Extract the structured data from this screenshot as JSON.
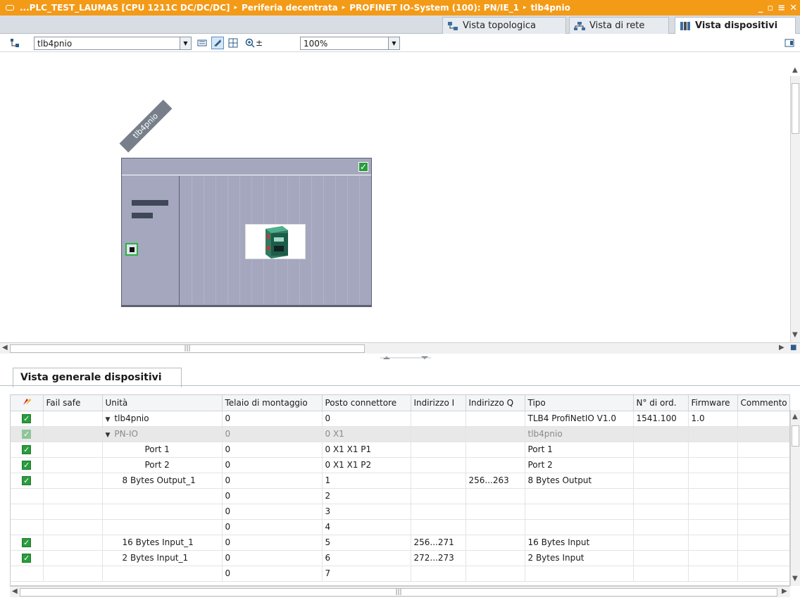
{
  "titlebar": {
    "crumbs": [
      "...PLC_TEST_LAUMAS [CPU 1211C DC/DC/DC]",
      "Periferia decentrata",
      "PROFINET IO-System (100): PN/IE_1",
      "tlb4pnio"
    ],
    "sep": "▸",
    "min": "_",
    "restore": "▫",
    "max": "≡",
    "close": "✕"
  },
  "view_tabs": {
    "topology": "Vista topologica",
    "network": "Vista di rete",
    "device": "Vista dispositivi"
  },
  "toolbar": {
    "device_select": "tlb4pnio",
    "zoom": "100%"
  },
  "canvas": {
    "device_name": "tlb4pnio",
    "status": "✓"
  },
  "panel": {
    "tab": "Vista generale dispositivi"
  },
  "table": {
    "headers": [
      "Fail safe",
      "Unità",
      "Telaio di montaggio",
      "Posto connettore",
      "Indirizzo I",
      "Indirizzo Q",
      "Tipo",
      "N° di ord.",
      "Firmware",
      "Commento"
    ],
    "rows": [
      {
        "check": "✓",
        "unit": "tlb4pnio",
        "rack": "0",
        "slot": "0",
        "i": "",
        "q": "",
        "type": "TLB4 ProfiNetIO V1.0",
        "order": "1541.100",
        "fw": "1.0",
        "comment": ""
      },
      {
        "check": "✓",
        "unit": "PN-IO",
        "rack": "0",
        "slot": "0 X1",
        "i": "",
        "q": "",
        "type": "tlb4pnio",
        "order": "",
        "fw": "",
        "comment": ""
      },
      {
        "check": "✓",
        "unit": "Port 1",
        "rack": "0",
        "slot": "0 X1 X1 P1",
        "i": "",
        "q": "",
        "type": "Port 1",
        "order": "",
        "fw": "",
        "comment": ""
      },
      {
        "check": "✓",
        "unit": "Port 2",
        "rack": "0",
        "slot": "0 X1 X1 P2",
        "i": "",
        "q": "",
        "type": "Port 2",
        "order": "",
        "fw": "",
        "comment": ""
      },
      {
        "check": "✓",
        "unit": "8 Bytes Output_1",
        "rack": "0",
        "slot": "1",
        "i": "",
        "q": "256...263",
        "type": "8 Bytes Output",
        "order": "",
        "fw": "",
        "comment": ""
      },
      {
        "check": "",
        "unit": "",
        "rack": "0",
        "slot": "2",
        "i": "",
        "q": "",
        "type": "",
        "order": "",
        "fw": "",
        "comment": ""
      },
      {
        "check": "",
        "unit": "",
        "rack": "0",
        "slot": "3",
        "i": "",
        "q": "",
        "type": "",
        "order": "",
        "fw": "",
        "comment": ""
      },
      {
        "check": "",
        "unit": "",
        "rack": "0",
        "slot": "4",
        "i": "",
        "q": "",
        "type": "",
        "order": "",
        "fw": "",
        "comment": ""
      },
      {
        "check": "✓",
        "unit": "16 Bytes Input_1",
        "rack": "0",
        "slot": "5",
        "i": "256...271",
        "q": "",
        "type": "16 Bytes Input",
        "order": "",
        "fw": "",
        "comment": ""
      },
      {
        "check": "✓",
        "unit": "2 Bytes Input_1",
        "rack": "0",
        "slot": "6",
        "i": "272...273",
        "q": "",
        "type": "2 Bytes Input",
        "order": "",
        "fw": "",
        "comment": ""
      },
      {
        "check": "",
        "unit": "",
        "rack": "0",
        "slot": "7",
        "i": "",
        "q": "",
        "type": "",
        "order": "",
        "fw": "",
        "comment": ""
      }
    ]
  }
}
